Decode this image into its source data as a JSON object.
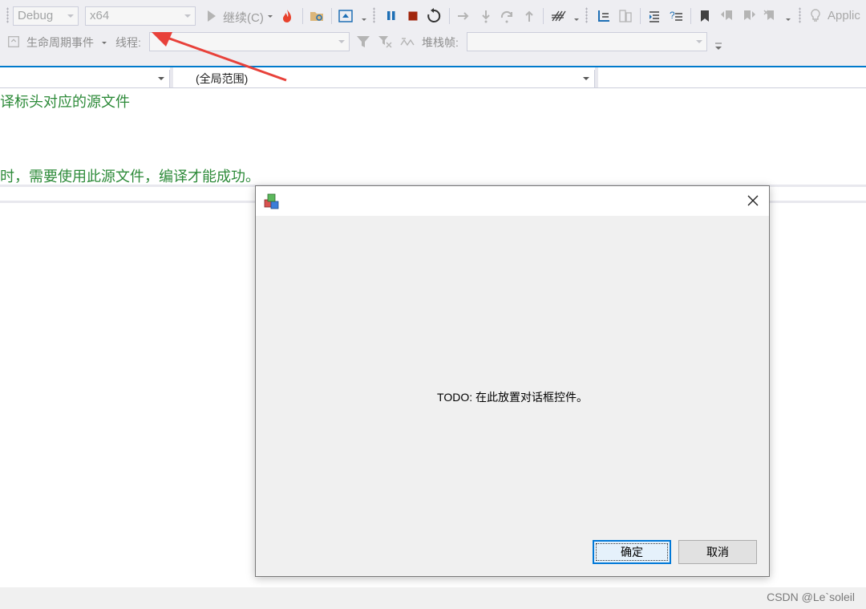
{
  "toolbar": {
    "config": "Debug",
    "platform": "x64",
    "continue_label": "继续(C)",
    "app_label": "Applic",
    "lifecycle_label": "生命周期事件",
    "thread_label": "线程:",
    "stack_frame_label": "堆栈帧:"
  },
  "navbar": {
    "scope": "(全局范围)"
  },
  "editor": {
    "line1": "译标头对应的源文件",
    "line2": "时，需要使用此源文件，编译才能成功。"
  },
  "dialog": {
    "message": "TODO: 在此放置对话框控件。",
    "ok_label": "确定",
    "cancel_label": "取消"
  },
  "watermark": "CSDN @Le`soleil",
  "colors": {
    "annotation_arrow": "#e8413a",
    "comment_green": "#2e8b3a",
    "accent_blue": "#007acc"
  }
}
